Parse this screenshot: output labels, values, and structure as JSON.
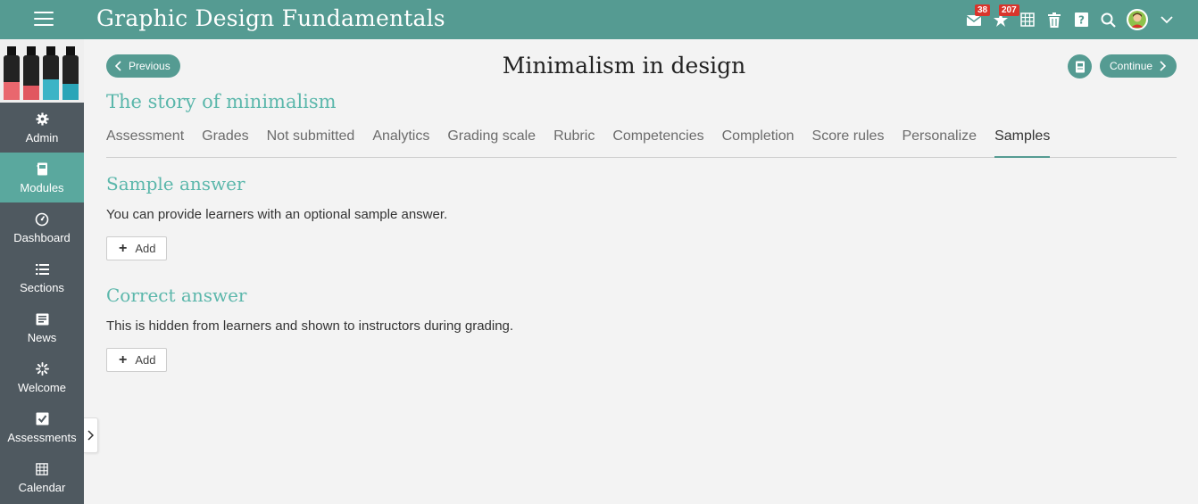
{
  "topbar": {
    "title": "Graphic Design Fundamentals",
    "messages_badge": "38",
    "notifications_badge": "207",
    "icons": [
      "menu-icon",
      "messages-icon",
      "notifications-icon",
      "calendar-icon",
      "trash-icon",
      "help-icon",
      "search-icon",
      "user-avatar",
      "chevron-down-icon"
    ]
  },
  "sidebar": {
    "items": [
      {
        "label": "Admin",
        "icon": "gear-icon"
      },
      {
        "label": "Modules",
        "icon": "notebook-icon"
      },
      {
        "label": "Dashboard",
        "icon": "dashboard-icon"
      },
      {
        "label": "Sections",
        "icon": "list-icon"
      },
      {
        "label": "News",
        "icon": "news-icon"
      },
      {
        "label": "Welcome",
        "icon": "welcome-icon"
      },
      {
        "label": "Assessments",
        "icon": "check-icon"
      },
      {
        "label": "Calendar",
        "icon": "calendar-icon"
      }
    ],
    "active": "Modules"
  },
  "page": {
    "previous_label": "Previous",
    "continue_label": "Continue",
    "title": "Minimalism in design",
    "section_title": "The story of minimalism"
  },
  "tabs": [
    "Assessment",
    "Grades",
    "Not submitted",
    "Analytics",
    "Grading scale",
    "Rubric",
    "Competencies",
    "Completion",
    "Score rules",
    "Personalize",
    "Samples"
  ],
  "active_tab": "Samples",
  "sample_answer": {
    "title": "Sample answer",
    "description": "You can provide learners with an optional sample answer.",
    "add_label": "Add"
  },
  "correct_answer": {
    "title": "Correct answer",
    "description": "This is hidden from learners and shown to instructors during grading.",
    "add_label": "Add"
  },
  "colors": {
    "topbar": "#559b92",
    "sidebar": "#4f5960",
    "sidebar_active": "#5aa89e",
    "accent_title": "#5bb7ab",
    "badge": "#d9342b"
  }
}
